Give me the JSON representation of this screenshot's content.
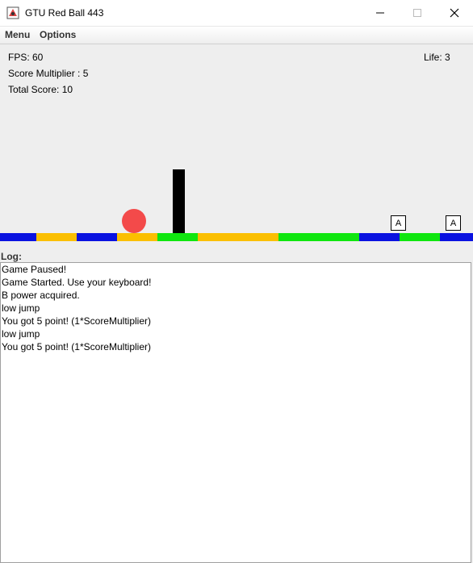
{
  "window": {
    "title": "GTU Red Ball 443"
  },
  "menubar": {
    "items": [
      "Menu",
      "Options"
    ]
  },
  "hud": {
    "fps_text": "FPS: 60",
    "multiplier_text": "Score Multiplier : 5",
    "score_text": "Total Score: 10",
    "life_text": "Life: 3"
  },
  "colors": {
    "ball": "#f34a4a",
    "blue": "#0a12e0",
    "yellow": "#fbbf00",
    "green": "#0fe60f",
    "obstacle": "#000000"
  },
  "ground_segments": [
    "blue",
    "yellow",
    "blue",
    "yellow",
    "green",
    "yellow",
    "yellow",
    "green",
    "green",
    "blue",
    "green",
    "blue"
  ],
  "powerups": [
    "A",
    "A"
  ],
  "log": {
    "label": "Log:",
    "lines": [
      "Game Paused!",
      "Game Started. Use your keyboard!",
      "B power acquired.",
      "low jump",
      "You got 5 point! (1*ScoreMultiplier)",
      "low jump",
      "You got 5 point! (1*ScoreMultiplier)"
    ]
  }
}
